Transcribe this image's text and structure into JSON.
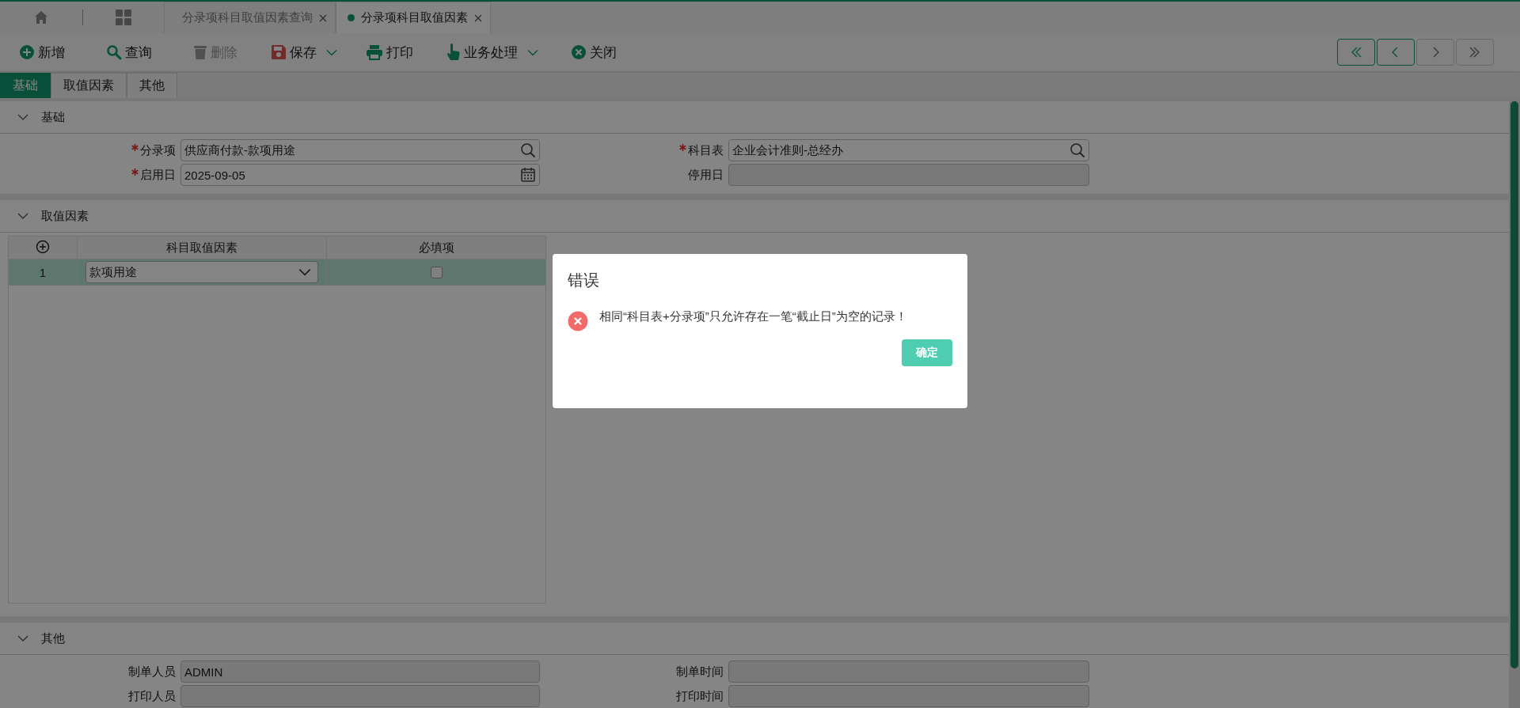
{
  "page_tabs": [
    {
      "label": "分录项科目取值因素查询",
      "selected": false
    },
    {
      "label": "分录项科目取值因素",
      "selected": true
    }
  ],
  "toolbar": [
    {
      "label": "新增",
      "disabled": false,
      "dropdown": false
    },
    {
      "label": "查询",
      "disabled": false,
      "dropdown": false
    },
    {
      "label": "删除",
      "disabled": true,
      "dropdown": false
    },
    {
      "label": "保存",
      "disabled": false,
      "dropdown": true
    },
    {
      "label": "打印",
      "disabled": false,
      "dropdown": false
    },
    {
      "label": "业务处理",
      "disabled": false,
      "dropdown": true
    },
    {
      "label": "关闭",
      "disabled": false,
      "dropdown": false
    }
  ],
  "pager": [
    {
      "kind": "first",
      "disabled": false
    },
    {
      "kind": "previous",
      "disabled": false
    },
    {
      "kind": "next",
      "disabled": true
    },
    {
      "kind": "last",
      "disabled": true
    }
  ],
  "form_tabs": [
    {
      "label": "基础",
      "selected": true
    },
    {
      "label": "取值因素",
      "selected": false
    },
    {
      "label": "其他",
      "selected": false
    }
  ],
  "sections": [
    {
      "title": "基础",
      "expanded": true,
      "kind": "form",
      "fields": [
        {
          "label": "分录项",
          "required": true,
          "value": "供应商付款-款项用途",
          "kind": "lookup",
          "disabled": false
        },
        {
          "label": "科目表",
          "required": true,
          "value": "企业会计准则-总经办",
          "kind": "lookup",
          "disabled": false
        },
        {
          "label": "启用日",
          "required": true,
          "value": "2025-09-05",
          "kind": "date",
          "disabled": false
        },
        {
          "label": "停用日",
          "required": false,
          "kind": "text",
          "disabled": true
        }
      ]
    },
    {
      "title": "取值因素",
      "expanded": true,
      "kind": "grid",
      "grid": {
        "columns": [
          "科目取值因素",
          "必填项"
        ],
        "rows": [
          {
            "index": "1",
            "factor": "款项用途",
            "required": false,
            "selected": true
          }
        ]
      }
    },
    {
      "title": "其他",
      "expanded": true,
      "kind": "form",
      "fields": [
        {
          "label": "制单人员",
          "required": false,
          "value": "ADMIN",
          "kind": "text",
          "disabled": true
        },
        {
          "label": "制单时间",
          "required": false,
          "kind": "text",
          "disabled": true
        },
        {
          "label": "打印人员",
          "required": false,
          "kind": "text",
          "disabled": true
        },
        {
          "label": "打印时间",
          "required": false,
          "kind": "text",
          "disabled": true
        }
      ]
    }
  ],
  "dialog": {
    "title": "错误",
    "message": "相同“科目表+分录项”只允许存在一笔“截止日”为空的记录！",
    "button": "确定"
  }
}
